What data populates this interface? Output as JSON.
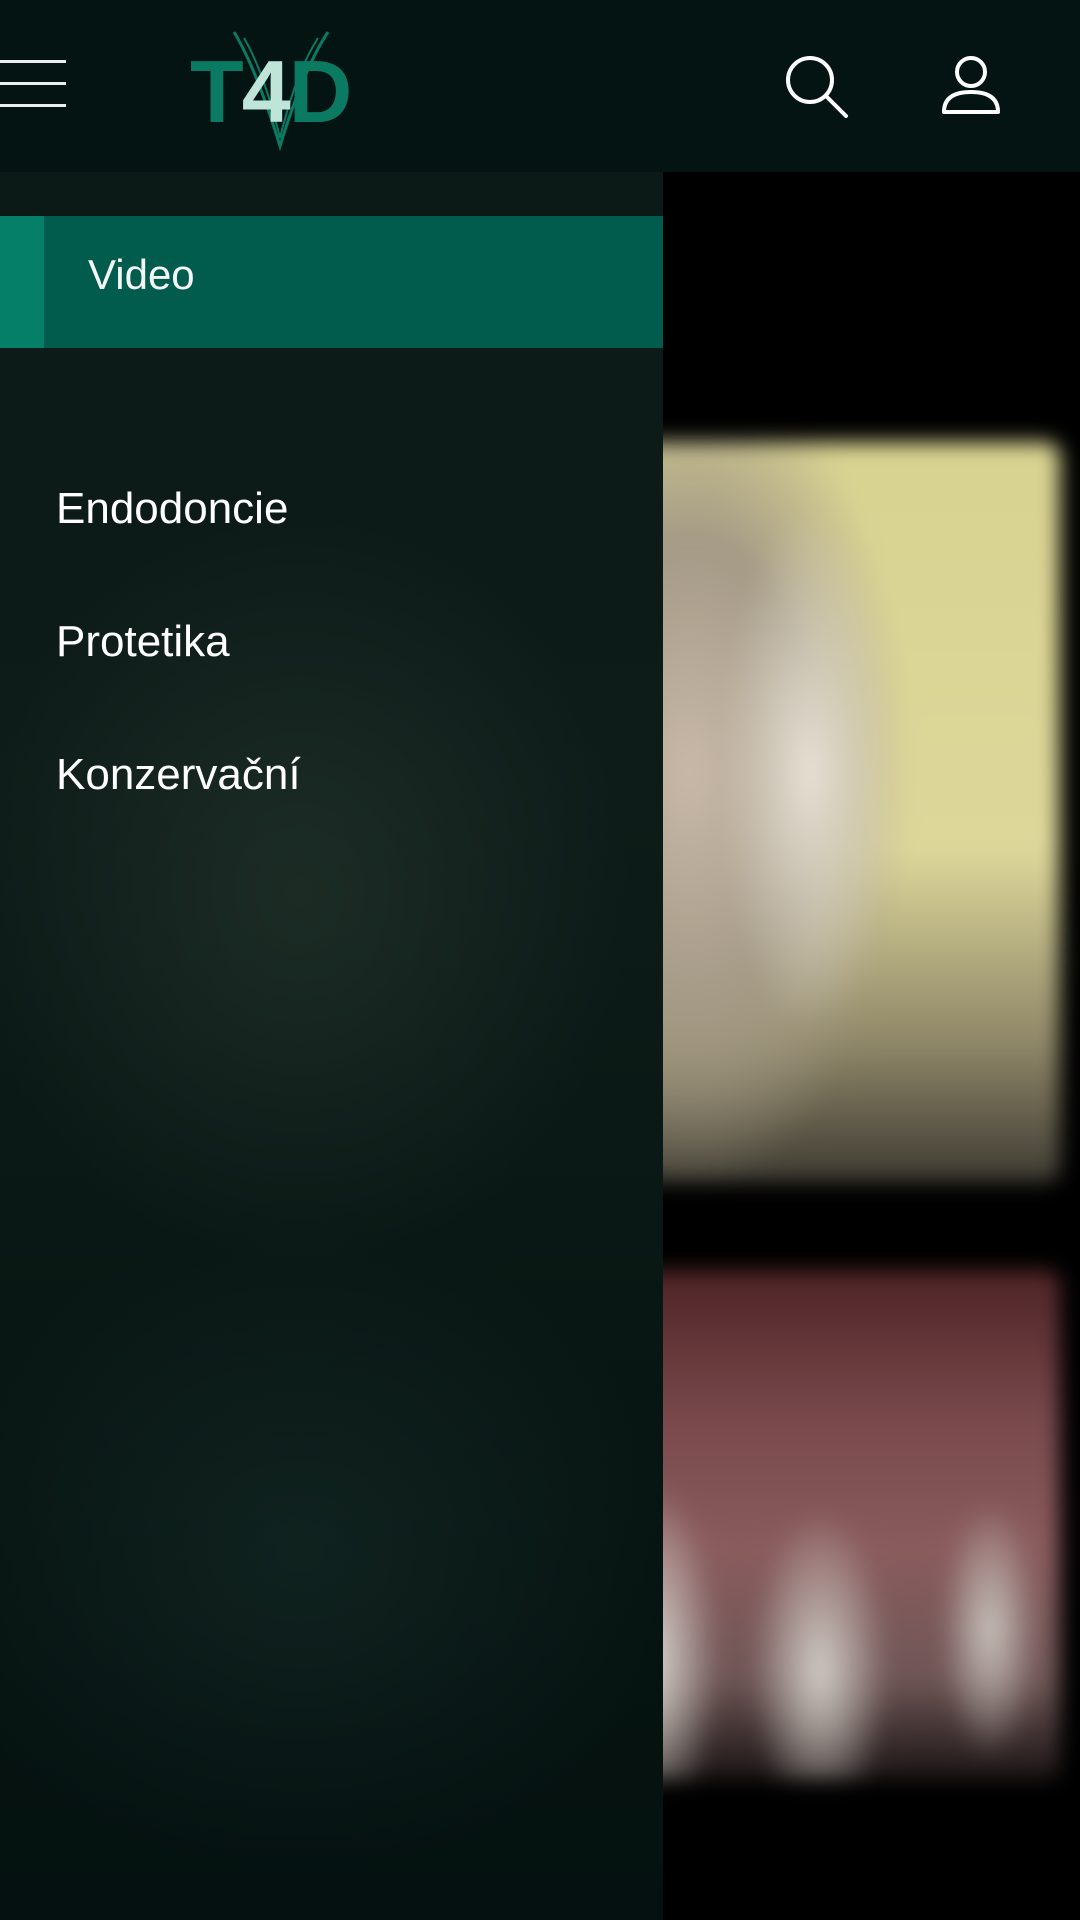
{
  "header": {
    "menu_icon": "hamburger-icon",
    "logo": {
      "text": "T4D",
      "colors": {
        "primary": "#0a7a62",
        "highlight": "#bfe4d8"
      }
    },
    "search_icon": "search-icon",
    "profile_icon": "user-icon"
  },
  "drawer": {
    "header_label": "Video",
    "items": [
      {
        "label": "Endodoncie"
      },
      {
        "label": "Protetika"
      },
      {
        "label": "Konzervační"
      }
    ]
  },
  "colors": {
    "topbar": "#031412",
    "drawer_header": "#015c4e",
    "drawer_accent": "#067f68",
    "text": "#ffffff"
  }
}
